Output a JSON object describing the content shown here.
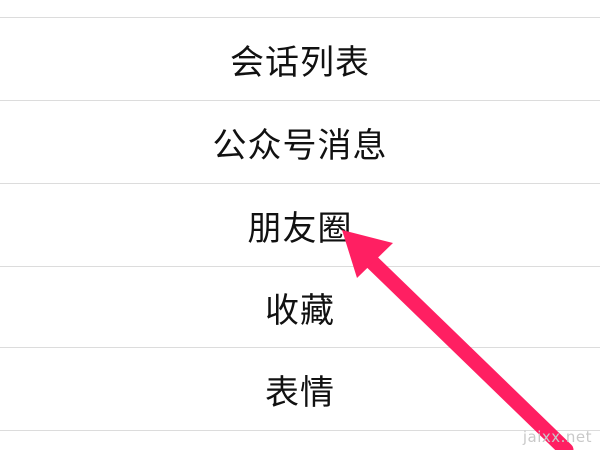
{
  "menu": {
    "items": [
      {
        "label": "会话列表"
      },
      {
        "label": "公众号消息"
      },
      {
        "label": "朋友圈"
      },
      {
        "label": "收藏"
      },
      {
        "label": "表情"
      }
    ]
  },
  "annotation": {
    "arrow_color": "#ff1f62",
    "pointing_to": "朋友圈"
  },
  "watermark": {
    "text": "jaixx.net"
  },
  "colors": {
    "divider": "#dcdcdc",
    "text": "#111111",
    "background": "#ffffff"
  }
}
